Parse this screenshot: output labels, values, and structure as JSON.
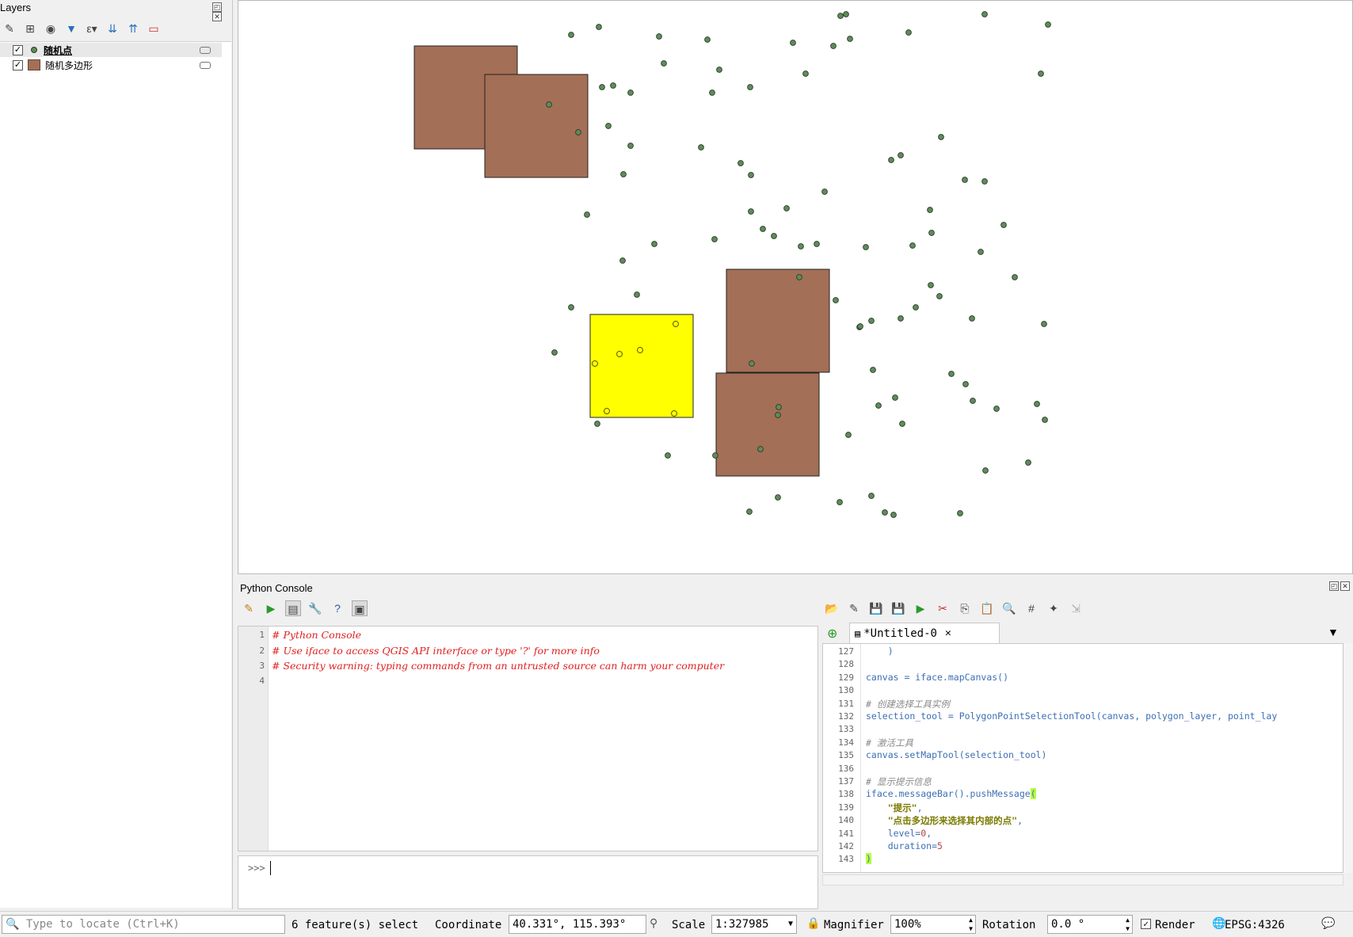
{
  "layers_panel": {
    "title": "Layers",
    "layers": [
      {
        "name": "随机点",
        "checked": "✓",
        "type": "point"
      },
      {
        "name": "随机多边形",
        "checked": "✓",
        "type": "polygon"
      }
    ]
  },
  "map": {
    "point_color": "#5e8c5a",
    "polygon_color": "#a36f56",
    "selected_color": "#ffff00",
    "polygons": [
      {
        "sel": false,
        "x": 0,
        "y": 0
      },
      {
        "sel": false,
        "x": 0,
        "y": 0
      },
      {
        "sel": true,
        "x": 0,
        "y": 0
      },
      {
        "sel": false,
        "x": 0,
        "y": 0
      },
      {
        "sel": false,
        "x": 0,
        "y": 0
      }
    ]
  },
  "console": {
    "title": "Python Console",
    "lines": [
      {
        "no": "1",
        "text": "# Python Console"
      },
      {
        "no": "2",
        "text": "# Use iface to access QGIS API interface or type '?' for more info"
      },
      {
        "no": "3",
        "text": "# Security warning: typing commands from an untrusted source can harm your computer"
      },
      {
        "no": "4",
        "text": ""
      }
    ],
    "prompt": ">>>"
  },
  "editor": {
    "tab_label": "*Untitled-0",
    "tab_close": "✕",
    "lines": [
      {
        "no": "127",
        "text": "    )"
      },
      {
        "no": "128",
        "text": ""
      },
      {
        "no": "129",
        "text": "canvas = iface.mapCanvas()"
      },
      {
        "no": "130",
        "text": ""
      },
      {
        "no": "131",
        "text": "# 创建选择工具实例"
      },
      {
        "no": "132",
        "text": "selection_tool = PolygonPointSelectionTool(canvas, polygon_layer, point_lay"
      },
      {
        "no": "133",
        "text": ""
      },
      {
        "no": "134",
        "text": "# 激活工具"
      },
      {
        "no": "135",
        "text": "canvas.setMapTool(selection_tool)"
      },
      {
        "no": "136",
        "text": ""
      },
      {
        "no": "137",
        "text": "# 显示提示信息"
      },
      {
        "no": "138",
        "text": "iface.messageBar().pushMessage("
      },
      {
        "no": "139",
        "text": "    \"提示\","
      },
      {
        "no": "140",
        "text": "    \"点击多边形来选择其内部的点\","
      },
      {
        "no": "141",
        "text": "    level=0,"
      },
      {
        "no": "142",
        "text": "    duration=5"
      },
      {
        "no": "143",
        "text": ")"
      }
    ]
  },
  "status": {
    "locate_placeholder": "Type to locate (Ctrl+K)",
    "selected_text": "6 feature(s) select",
    "coordinate_label": "Coordinate",
    "coordinate_value": "40.331°, 115.393°",
    "scale_label": "Scale",
    "scale_value": "1:327985",
    "magnifier_label": "Magnifier",
    "magnifier_value": "100%",
    "rotation_label": "Rotation",
    "rotation_value": "0.0 °",
    "render_label": "Render",
    "render_checked": "✓",
    "crs": "EPSG:4326"
  }
}
